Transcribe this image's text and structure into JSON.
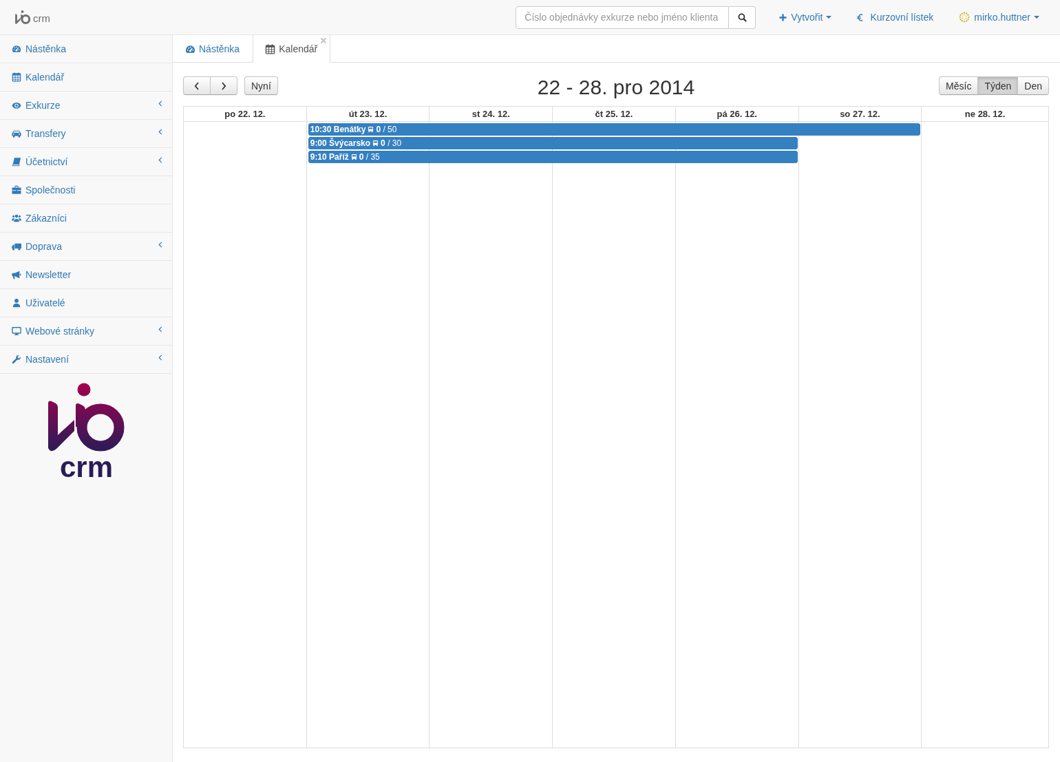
{
  "top_bar": {
    "logo": {
      "text": "crm"
    },
    "search": {
      "placeholder": "Číslo objednávky exkurze nebo jméno klienta"
    },
    "nav": [
      {
        "kind": "create",
        "label": "Vytvořit",
        "dropdown": true
      },
      {
        "kind": "rates",
        "label": "Kurzovní lístek",
        "dropdown": false
      },
      {
        "kind": "user",
        "label": "mirko.huttner",
        "dropdown": true
      }
    ]
  },
  "sidebar": {
    "items": [
      {
        "label": "Nástěnka",
        "expandable": false
      },
      {
        "label": "Kalendář",
        "expandable": false
      },
      {
        "label": "Exkurze",
        "expandable": true
      },
      {
        "label": "Transfery",
        "expandable": true
      },
      {
        "label": "Účetnictví",
        "expandable": true
      },
      {
        "label": "Společnosti",
        "expandable": false
      },
      {
        "label": "Zákazníci",
        "expandable": false
      },
      {
        "label": "Doprava",
        "expandable": true
      },
      {
        "label": "Newsletter",
        "expandable": false
      },
      {
        "label": "Uživatelé",
        "expandable": false
      },
      {
        "label": "Webové stránky",
        "expandable": true
      },
      {
        "label": "Nastavení",
        "expandable": true
      }
    ],
    "logo": {
      "text": "crm"
    }
  },
  "tabs": [
    {
      "label": "Nástěnka",
      "selected": false,
      "closable": false
    },
    {
      "label": "Kalendář",
      "selected": true,
      "closable": true
    }
  ],
  "calendar": {
    "today_button": "Nyní",
    "title": "22 - 28. pro 2014",
    "views": [
      {
        "label": "Měsíc",
        "selected": false
      },
      {
        "label": "Týden",
        "selected": true
      },
      {
        "label": "Den",
        "selected": false
      }
    ],
    "days": [
      "po 22. 12.",
      "út 23. 12.",
      "st 24. 12.",
      "čt 25. 12.",
      "pá 26. 12.",
      "so 27. 12.",
      "ne 28. 12."
    ],
    "event_rows": [
      {
        "cells": [
          {
            "kind": "empty"
          },
          {
            "kind": "event",
            "label": "10:30 Benátky",
            "seats": "**0** / 50"
          },
          {
            "kind": "continued"
          },
          {
            "kind": "continued"
          },
          {
            "kind": "continued"
          },
          {
            "kind": "continued"
          },
          {
            "kind": "empty"
          }
        ]
      },
      {
        "cells": [
          {
            "kind": "empty"
          },
          {
            "kind": "event",
            "label": "9:00 Švýcarsko",
            "seats": "**0** / 30"
          },
          {
            "kind": "continued"
          },
          {
            "kind": "continued"
          },
          {
            "kind": "continued"
          },
          {
            "kind": "empty"
          },
          {
            "kind": "empty"
          }
        ]
      },
      {
        "cells": [
          {
            "kind": "empty"
          },
          {
            "kind": "event",
            "label": "9:10 Paříž",
            "seats": "**0** / 35"
          },
          {
            "kind": "continued"
          },
          {
            "kind": "continued"
          },
          {
            "kind": "continued"
          },
          {
            "kind": "empty"
          },
          {
            "kind": "empty"
          }
        ]
      }
    ]
  }
}
